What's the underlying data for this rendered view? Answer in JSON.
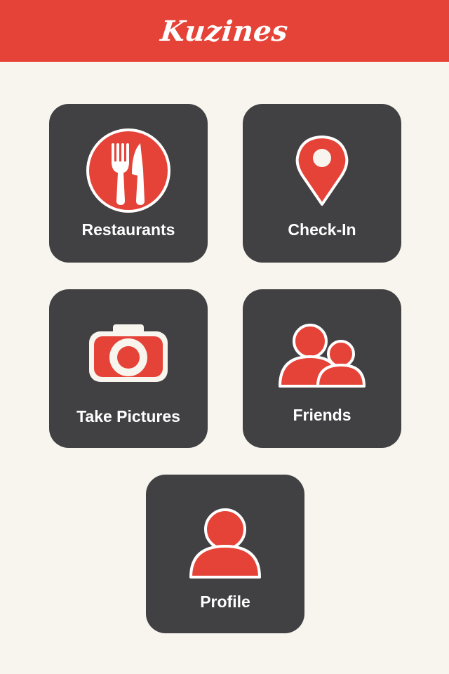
{
  "header": {
    "title": "Kuzines",
    "background_color": "#E64338"
  },
  "colors": {
    "background": "#F8F4EE",
    "tile": "#414042",
    "accent": "#E64338",
    "icon_outline": "#FFFFFF"
  },
  "menu": [
    {
      "id": "restaurants",
      "label": "Restaurants",
      "icon": "fork-knife-icon"
    },
    {
      "id": "checkin",
      "label": "Check-In",
      "icon": "map-pin-icon"
    },
    {
      "id": "pictures",
      "label": "Take Pictures",
      "icon": "camera-icon"
    },
    {
      "id": "friends",
      "label": "Friends",
      "icon": "friends-icon"
    },
    {
      "id": "profile",
      "label": "Profile",
      "icon": "person-icon"
    }
  ]
}
